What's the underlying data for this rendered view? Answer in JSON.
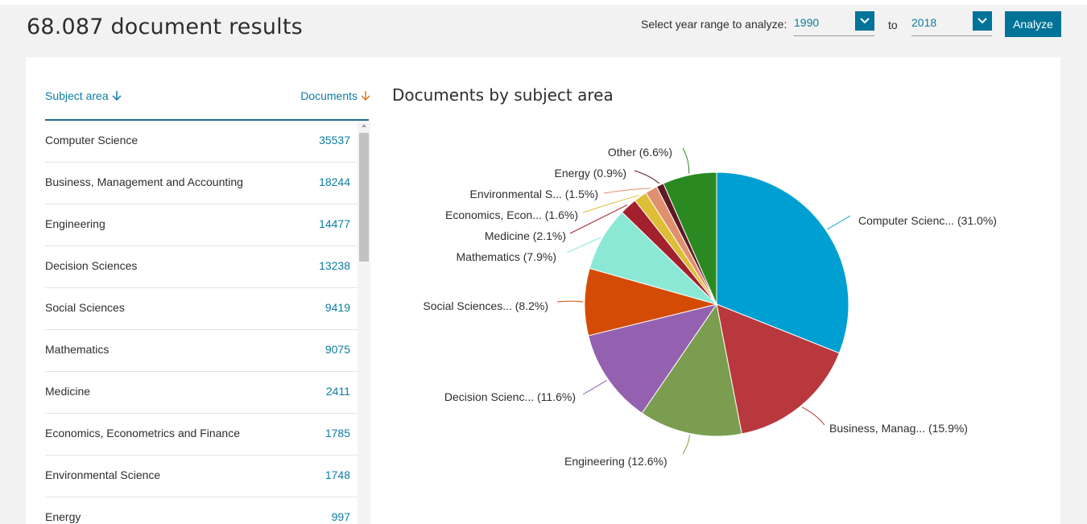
{
  "header": {
    "results_title": "68.087 document results",
    "year_range_label": "Select year range to analyze:",
    "from_year": "1990",
    "to_label": "to",
    "to_year": "2018",
    "analyze_label": "Analyze"
  },
  "table": {
    "col_subject": "Subject area",
    "col_documents": "Documents",
    "rows": [
      {
        "name": "Computer Science",
        "count": "35537"
      },
      {
        "name": "Business, Management and Accounting",
        "count": "18244"
      },
      {
        "name": "Engineering",
        "count": "14477"
      },
      {
        "name": "Decision Sciences",
        "count": "13238"
      },
      {
        "name": "Social Sciences",
        "count": "9419"
      },
      {
        "name": "Mathematics",
        "count": "9075"
      },
      {
        "name": "Medicine",
        "count": "2411"
      },
      {
        "name": "Economics, Econometrics and Finance",
        "count": "1785"
      },
      {
        "name": "Environmental Science",
        "count": "1748"
      },
      {
        "name": "Energy",
        "count": "997"
      }
    ]
  },
  "chart_data": {
    "type": "pie",
    "title": "Documents by subject area",
    "slices": [
      {
        "label": "Computer Scienc... (31.0%)",
        "value": 31.0,
        "color": "#009fd1"
      },
      {
        "label": "Business, Manag... (15.9%)",
        "value": 15.9,
        "color": "#b8383d"
      },
      {
        "label": "Engineering (12.6%)",
        "value": 12.6,
        "color": "#7b9d4f"
      },
      {
        "label": "Decision Scienc... (11.6%)",
        "value": 11.6,
        "color": "#9461b0"
      },
      {
        "label": "Social Sciences... (8.2%)",
        "value": 8.2,
        "color": "#d44b06"
      },
      {
        "label": "Mathematics (7.9%)",
        "value": 7.9,
        "color": "#8ae8d5"
      },
      {
        "label": "Medicine (2.1%)",
        "value": 2.1,
        "color": "#a3212d"
      },
      {
        "label": "Economics, Econ... (1.6%)",
        "value": 1.6,
        "color": "#ddbe36"
      },
      {
        "label": "Environmental S... (1.5%)",
        "value": 1.5,
        "color": "#e0906e"
      },
      {
        "label": "Energy (0.9%)",
        "value": 0.9,
        "color": "#5e1a24"
      },
      {
        "label": "Other (6.6%)",
        "value": 6.6,
        "color": "#2a8a21"
      }
    ]
  }
}
